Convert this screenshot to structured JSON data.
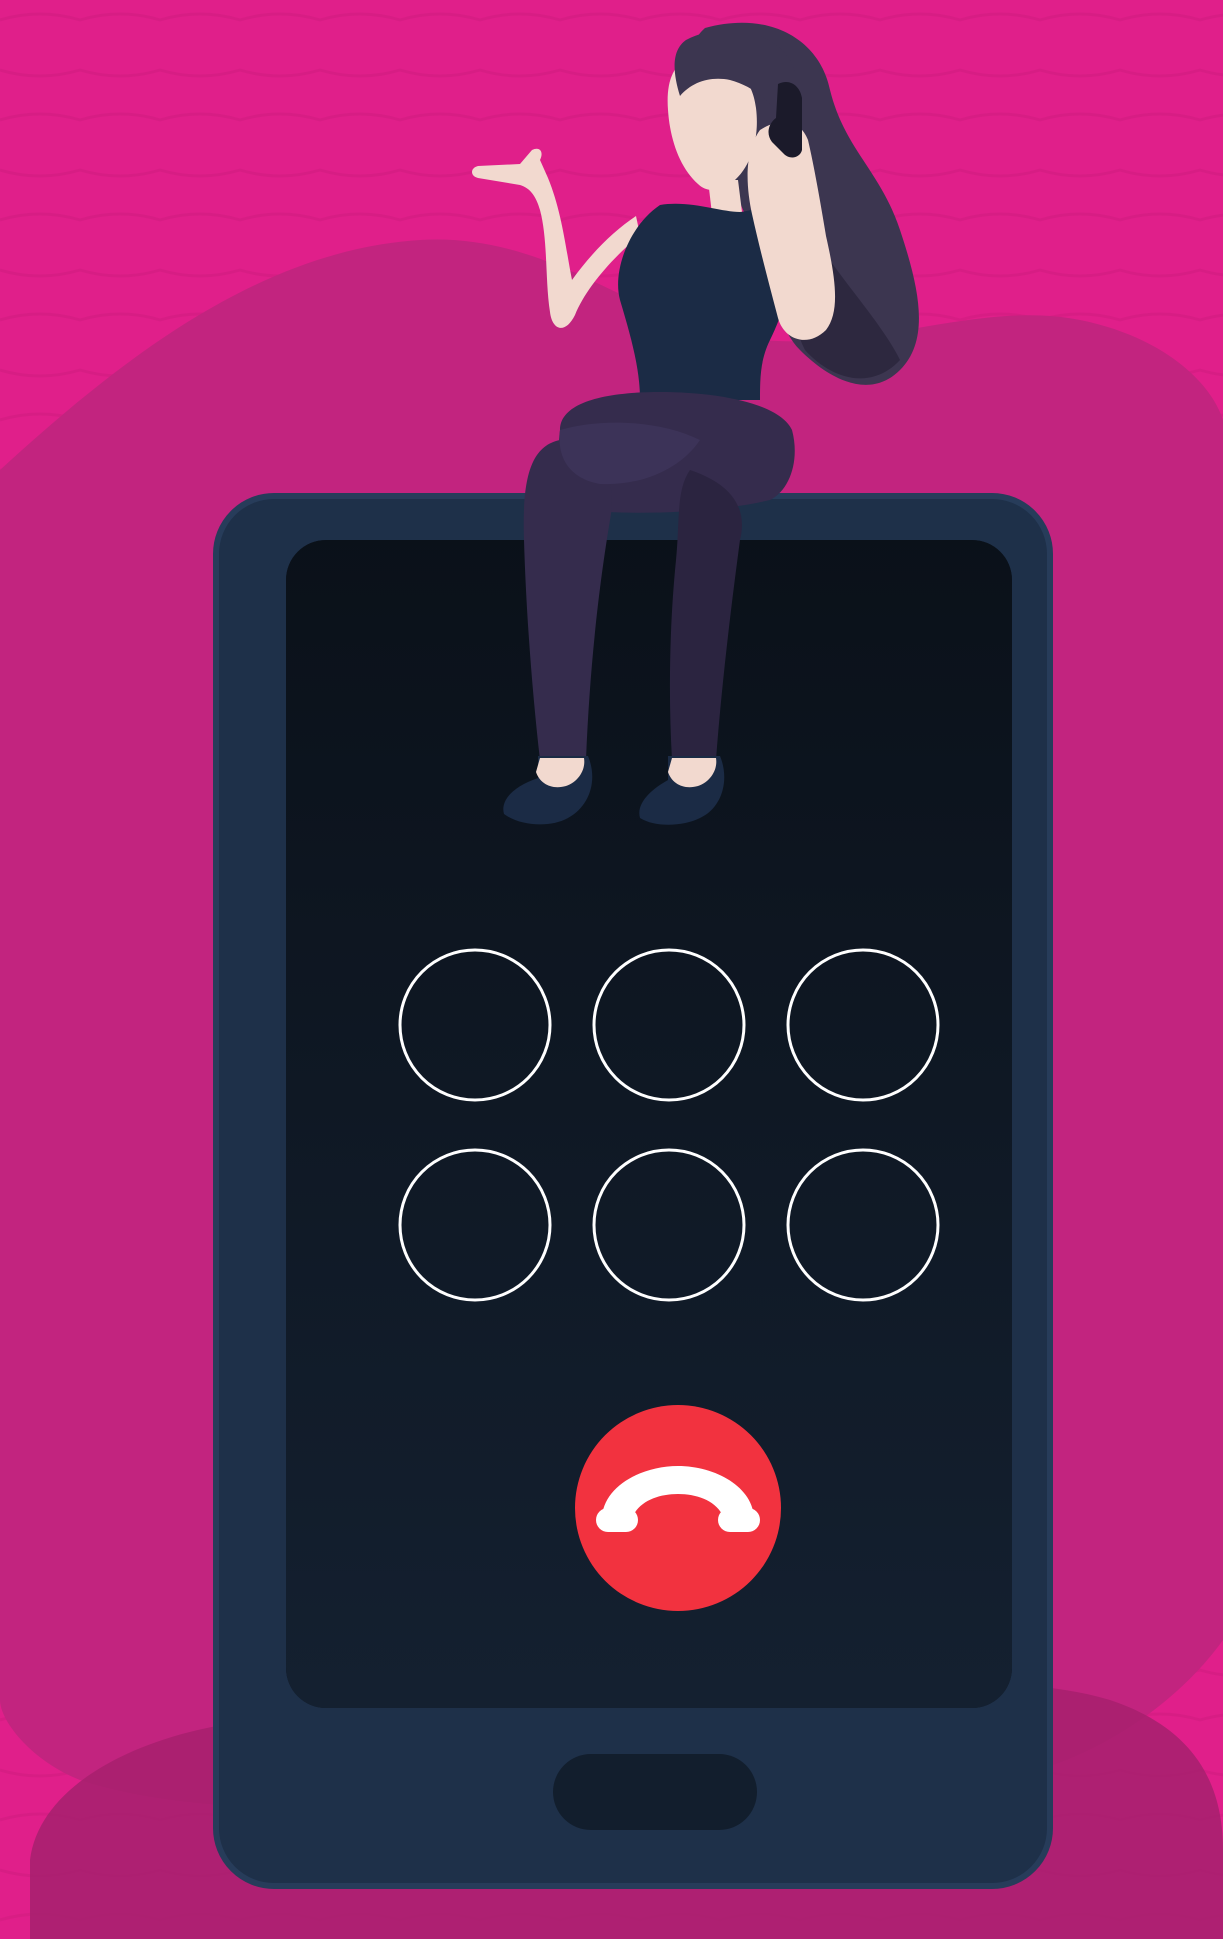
{
  "scene": {
    "colors": {
      "background": "#e01f8a",
      "background_waves": "#d11d80",
      "blob": "#c2247f",
      "blob_dark": "#a8206f",
      "phone_body": "#1e3049",
      "phone_screen": "#0d1520",
      "keypad_ring": "#ffffff",
      "end_call": "#f2323f",
      "skin": "#f2d9cf",
      "hair": "#3c3650",
      "outfit": "#1b2b45",
      "pants": "#352c4d",
      "shoes": "#1b2b45"
    },
    "phone": {
      "screen": "call-in-progress",
      "keypad": {
        "rows": 2,
        "columns": 3
      },
      "end_call_icon": "hang-up-phone-icon",
      "home_button": "home-button"
    },
    "figure": {
      "pose": "woman-sitting-on-phone-talking"
    }
  }
}
